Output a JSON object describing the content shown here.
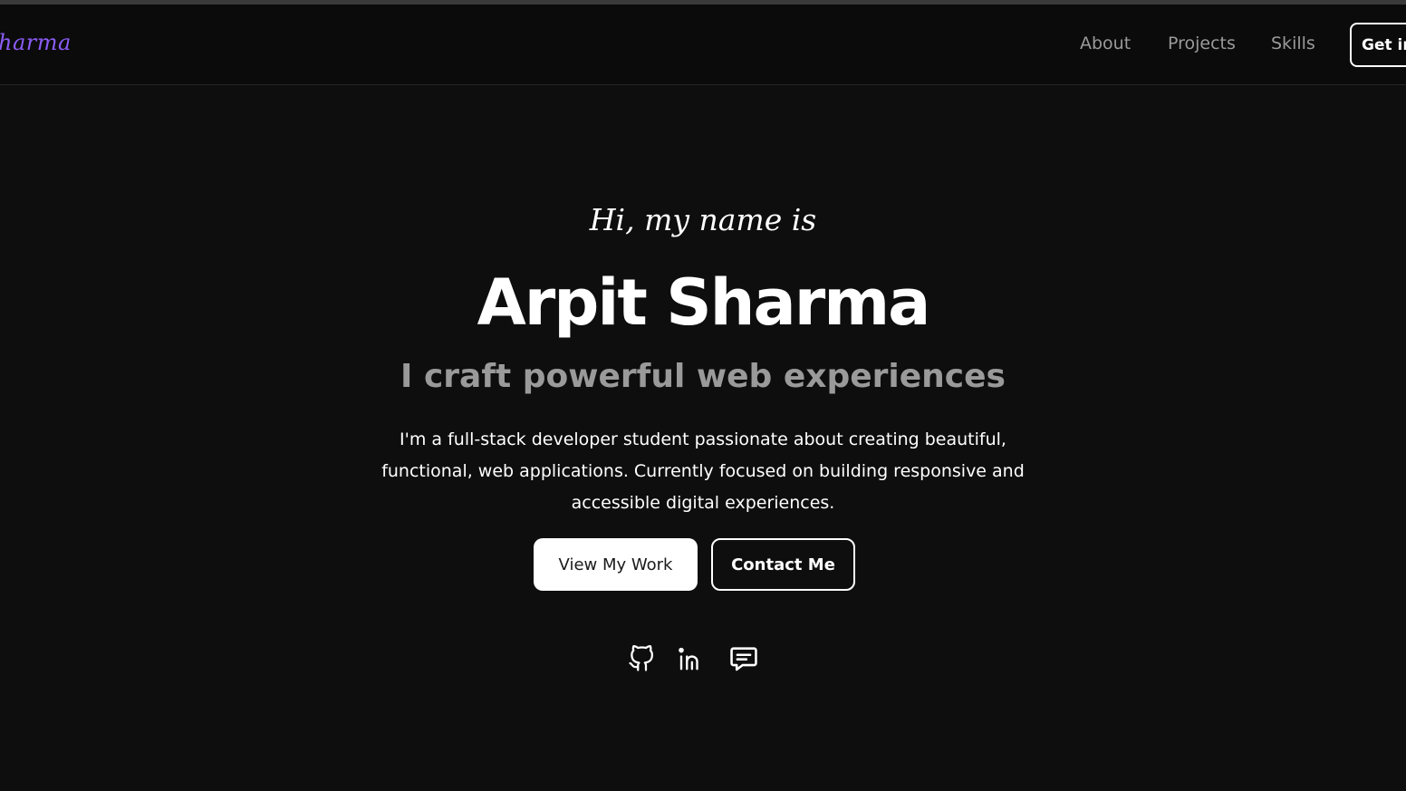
{
  "navbar": {
    "logo_text": "harma",
    "links": [
      {
        "label": "About"
      },
      {
        "label": "Projects"
      },
      {
        "label": "Skills"
      }
    ],
    "cta_label": "Get in"
  },
  "hero": {
    "greeting": "Hi, my name is",
    "name": "Arpit Sharma",
    "tagline": "I craft powerful web experiences",
    "bio": "I'm a full-stack developer student passionate about creating beautiful, functional, web applications. Currently focused on building responsive and accessible digital experiences.",
    "primary_button": "View My Work",
    "secondary_button": "Contact Me"
  },
  "socials": [
    {
      "icon": "github-icon"
    },
    {
      "icon": "linkedin-icon"
    },
    {
      "icon": "message-icon"
    }
  ],
  "colors": {
    "background": "#0e0e0e",
    "accent": "#8b5cf6",
    "muted": "#9a9a9a"
  }
}
